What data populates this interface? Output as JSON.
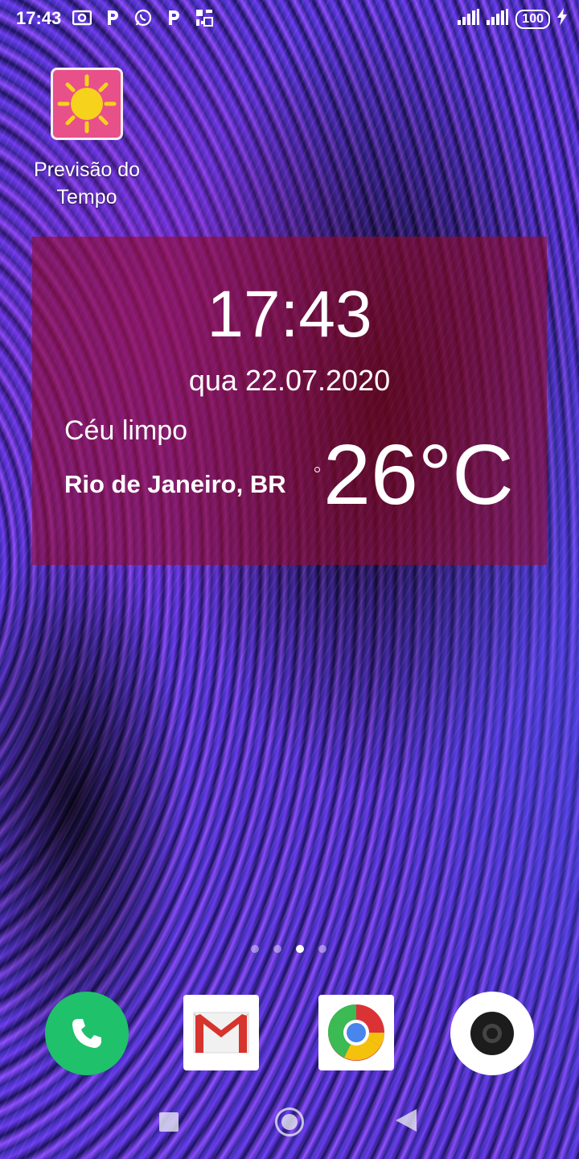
{
  "status_bar": {
    "time": "17:43",
    "battery": "100",
    "left_icons": [
      "screenshot-icon",
      "parking-app-icon",
      "whatsapp-icon",
      "parking-app-icon",
      "qr-app-icon"
    ],
    "right_icons": [
      "signal-icon",
      "signal-icon",
      "battery-icon",
      "charging-icon"
    ]
  },
  "app_shortcut": {
    "label_line1": "Previsão do",
    "label_line2": "Tempo",
    "icon": "sun-icon",
    "icon_bg": "#e8508a"
  },
  "weather_widget": {
    "time": "17:43",
    "date": "qua 22.07.2020",
    "condition": "Céu limpo",
    "city": "Rio de Janeiro, BR",
    "temperature": "26°C",
    "background": "#960a28"
  },
  "page_indicator": {
    "pages": 4,
    "active_page": 3
  },
  "dock": {
    "apps": [
      "phone-icon",
      "gmail-icon",
      "chrome-icon",
      "camera-icon"
    ],
    "phone_color": "#1fc16a"
  },
  "nav_bar": {
    "buttons": [
      "recents-button",
      "home-button",
      "back-button"
    ]
  }
}
